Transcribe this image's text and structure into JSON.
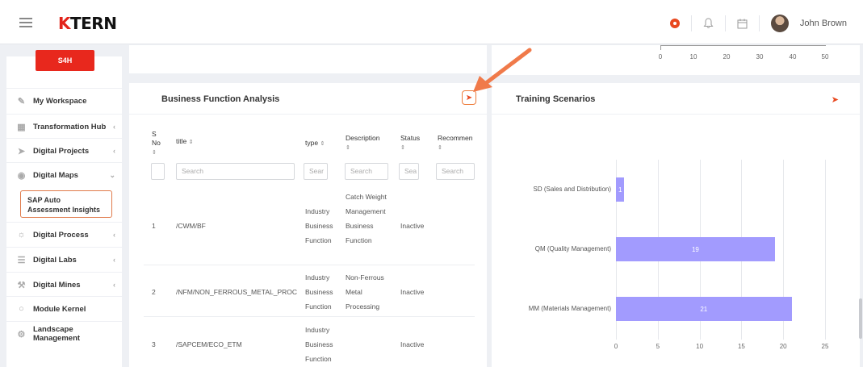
{
  "header": {
    "logo_k": "K",
    "logo_rest": "TERN",
    "user_name": "John Brown"
  },
  "sidebar": {
    "badge": "S4H",
    "items": [
      {
        "label": "My Workspace",
        "icon": "workspace-icon",
        "chevron": false
      },
      {
        "label": "Transformation Hub",
        "icon": "grid-icon",
        "chevron": true
      },
      {
        "label": "Digital Projects",
        "icon": "send-icon",
        "chevron": true
      },
      {
        "label": "Digital Maps",
        "icon": "map-pin-icon",
        "chevron": true
      },
      {
        "label": "Digital Process",
        "icon": "sun-icon",
        "chevron": true
      },
      {
        "label": "Digital Labs",
        "icon": "list-icon",
        "chevron": true
      },
      {
        "label": "Digital Mines",
        "icon": "pickaxe-icon",
        "chevron": true
      },
      {
        "label": "Module Kernel",
        "icon": "circle-icon",
        "chevron": false
      },
      {
        "label": "Landscape Management",
        "icon": "gear-icon",
        "chevron": false
      }
    ],
    "sub_item": "SAP Auto Assessment Insights"
  },
  "top_axis": {
    "ticks": [
      "0",
      "10",
      "20",
      "30",
      "40",
      "50"
    ]
  },
  "bfa": {
    "title": "Business Function Analysis",
    "columns": {
      "sno": "S No",
      "title": "title",
      "type": "type",
      "description": "Description",
      "status": "Status",
      "recommen": "Recommen"
    },
    "search_placeholders": {
      "title": "Search",
      "type": "Sear",
      "description": "Search",
      "status": "Sea",
      "recommen": "Search"
    },
    "rows": [
      {
        "sno": "1",
        "title": "/CWM/BF",
        "type": "Industry Business Function",
        "description": "Catch Weight Management Business Function",
        "status": "Inactive"
      },
      {
        "sno": "2",
        "title": "/NFM/NON_FERROUS_METAL_PROC",
        "type": "Industry Business Function",
        "description": "Non-Ferrous Metal Processing",
        "status": "Inactive"
      },
      {
        "sno": "3",
        "title": "/SAPCEM/ECO_ETM",
        "type": "Industry Business Function",
        "description": "",
        "status": "Inactive"
      }
    ]
  },
  "training": {
    "title": "Training Scenarios"
  },
  "chart_data": {
    "type": "bar",
    "orientation": "horizontal",
    "categories": [
      "SD (Sales and Distribution)",
      "QM (Quality Management)",
      "MM (Materials Management)"
    ],
    "values": [
      1,
      19,
      21
    ],
    "xlim": [
      0,
      25
    ],
    "xticks": [
      0,
      5,
      10,
      15,
      20,
      25
    ],
    "grid": true,
    "color": "#a29bfe"
  }
}
